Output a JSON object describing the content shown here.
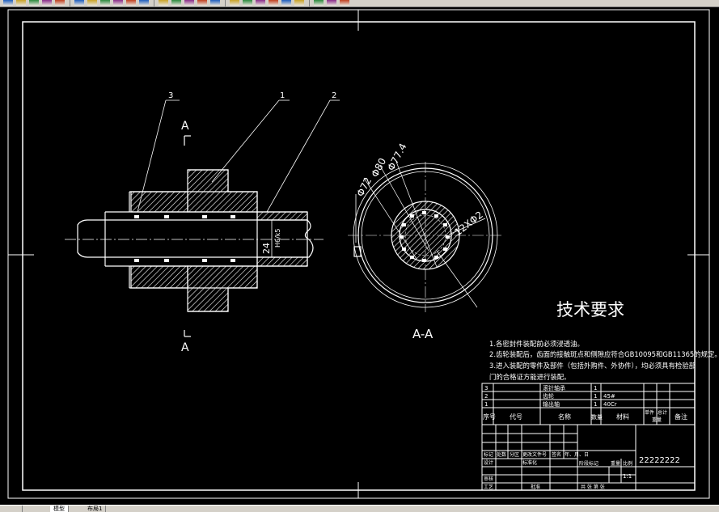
{
  "toolbar": {
    "buttons": [
      "new-icon",
      "open-icon",
      "save-icon",
      "print-icon",
      "preview-icon",
      "cut-icon",
      "copy-icon",
      "paste-icon",
      "match-icon",
      "undo-icon",
      "redo-icon",
      "pan-icon",
      "zoom-realtime-icon",
      "zoom-window-icon",
      "zoom-previous-icon",
      "properties-icon",
      "design-center-icon",
      "tool-palette-icon",
      "sheet-set-icon",
      "markup-icon",
      "calculator-icon",
      "help-icon",
      "layer-icon",
      "color-icon",
      "linetype-icon"
    ]
  },
  "colors": {
    "background": "#000000",
    "linework": "#ffffff",
    "hatch": "#ffffff",
    "toolbar": "#d4d0c8"
  },
  "drawing": {
    "section_top_letter": "A",
    "section_bottom_letter": "A",
    "section_view_title": "A-A",
    "balloons": [
      "3",
      "1",
      "2"
    ],
    "dim_shaft": "24",
    "dim_shaft_tol": "H6/k5",
    "dim_d1": "Φ77.4",
    "dim_d2": "Φ80",
    "dim_d3": "Φ72",
    "dim_holes": "12XΦ2"
  },
  "tech_req": {
    "title": "技术要求",
    "lines": [
      "1.各密封件装配前必须浸透油。",
      "2.齿轮装配后，齿面的接触斑点和侧隙应符合GB10095和GB11365的规定。",
      "3.进入装配的零件及部件（包括外购件、外协件），均必须具有检验部",
      "门的合格证方能进行装配。"
    ]
  },
  "parts_table": {
    "rows": [
      {
        "seq": "3",
        "name": "滚针轴承",
        "qty": "1",
        "material": ""
      },
      {
        "seq": "2",
        "name": "齿轮",
        "qty": "1",
        "material": "45#"
      },
      {
        "seq": "1",
        "name": "输出轴",
        "qty": "1",
        "material": "40Cr"
      }
    ],
    "headers": {
      "seq": "序号",
      "code": "代号",
      "name": "名称",
      "qty": "数量",
      "material": "材料",
      "single": "单件",
      "total": "总计",
      "weight": "重量",
      "remark": "备注"
    }
  },
  "title_block": {
    "drawing_no": "22222222",
    "scale": "1:1",
    "labels": {
      "mark": "标记",
      "count": "处数",
      "zone": "分区",
      "doc_no": "更改文件号",
      "sign": "签名",
      "date": "年、月、日",
      "design": "设计",
      "standardize": "标准化",
      "review": "审核",
      "process": "工艺",
      "approve": "批准",
      "stage": "阶段标记",
      "weight": "重量",
      "ratio": "比例",
      "sheets": "共 张 第 张"
    }
  },
  "tabs": [
    "模型",
    "布局1"
  ]
}
